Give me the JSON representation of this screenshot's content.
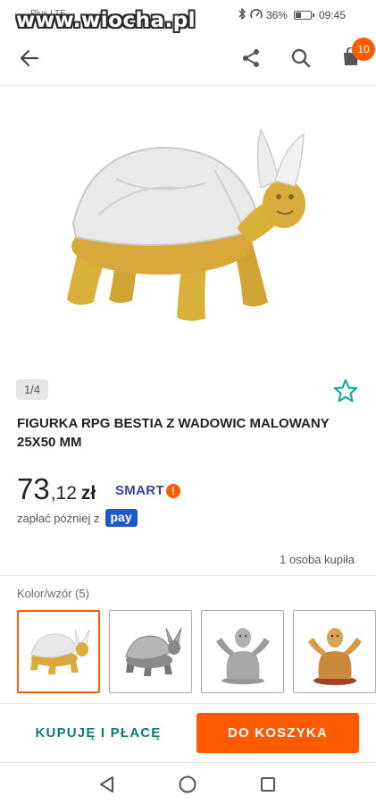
{
  "status_bar": {
    "carrier": "Plus LTE",
    "watermark": "www.wiocha.pl",
    "battery": "36%",
    "time": "09:45"
  },
  "app_bar": {
    "back_icon": "arrow-left-icon",
    "share_icon": "share-icon",
    "search_icon": "search-icon",
    "cart_icon": "cart-icon",
    "cart_badge": "10"
  },
  "product": {
    "image_index": "1/4",
    "title": "FIGURKA RPG BESTIA Z WADOWIC MALOWANY 25X50 MM",
    "price_int": "73",
    "price_rest": ",12",
    "currency": "zł",
    "smart_label": "SMART",
    "smart_mark": "!",
    "pay_later": "zapłać później z",
    "pay_logo": "pay",
    "buyers": "1 osoba kupiła"
  },
  "variants": {
    "label": "Kolor/wzór (5)",
    "items": [
      "painted-turtle",
      "grey-turtle",
      "grey-bust",
      "painted-bust"
    ]
  },
  "actions": {
    "buy_now": "KUPUJĘ I PŁACĘ",
    "add_to_cart": "DO KOSZYKA"
  },
  "colors": {
    "accent": "#ff5a00",
    "buy_text": "#0f7b6c",
    "star": "#1aa79a",
    "smart": "#3b3f9e"
  }
}
